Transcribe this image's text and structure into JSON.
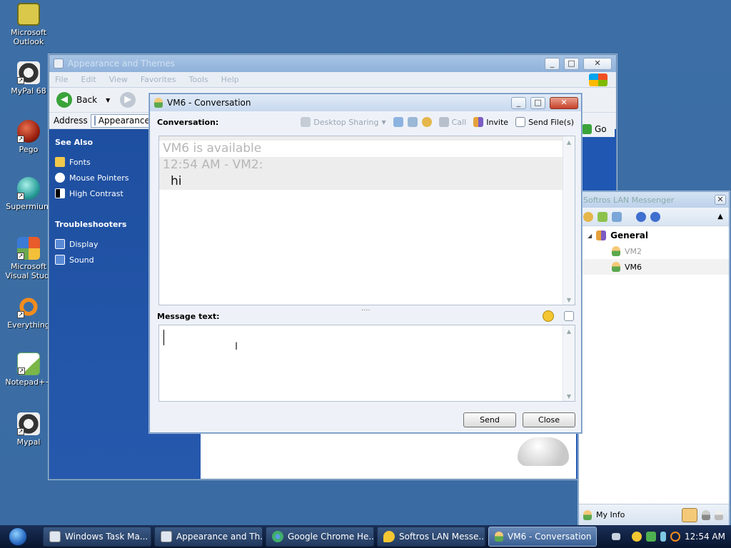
{
  "desktop": {
    "icons": [
      {
        "label": "Microsoft\nOutlook",
        "l1": "Microsoft",
        "l2": "Outlook"
      },
      {
        "l1": "MyPal 68",
        "l2": ""
      },
      {
        "l1": "Pego",
        "l2": ""
      },
      {
        "l1": "Supermium",
        "l2": ""
      },
      {
        "l1": "Microsoft",
        "l2": "Visual Stud."
      },
      {
        "l1": "Everything",
        "l2": ""
      },
      {
        "l1": "Notepad++",
        "l2": ""
      },
      {
        "l1": "Mypal",
        "l2": ""
      }
    ]
  },
  "appearance": {
    "title": "Appearance and Themes",
    "menu": [
      "File",
      "Edit",
      "View",
      "Favorites",
      "Tools",
      "Help"
    ],
    "back": "Back",
    "address_label": "Address",
    "address_value": "Appearance",
    "go": "Go",
    "see_also": "See Also",
    "see_also_items": [
      "Fonts",
      "Mouse Pointers",
      "High Contrast"
    ],
    "troubleshooters": "Troubleshooters",
    "troubleshooter_items": [
      "Display",
      "Sound"
    ]
  },
  "conversation": {
    "title": "VM6 - Conversation",
    "conversation_label": "Conversation:",
    "toolbar": {
      "desktop_sharing": "Desktop Sharing",
      "call": "Call",
      "invite": "Invite",
      "send_files": "Send File(s)"
    },
    "status_line": "VM6 is available",
    "msg_header": "12:54 AM - VM2:",
    "msg_text": "hi",
    "message_label": "Message text:",
    "send": "Send",
    "close": "Close"
  },
  "messenger": {
    "title": "Softros LAN Messenger",
    "group": "General",
    "contacts": [
      "VM2",
      "VM6"
    ],
    "my_info": "My Info"
  },
  "taskbar": {
    "tasks": [
      "Windows Task Ma...",
      "Appearance and Th...",
      "Google Chrome He...",
      "Softros LAN Messe...",
      "VM6 - Conversation"
    ],
    "clock": "12:54 AM"
  }
}
